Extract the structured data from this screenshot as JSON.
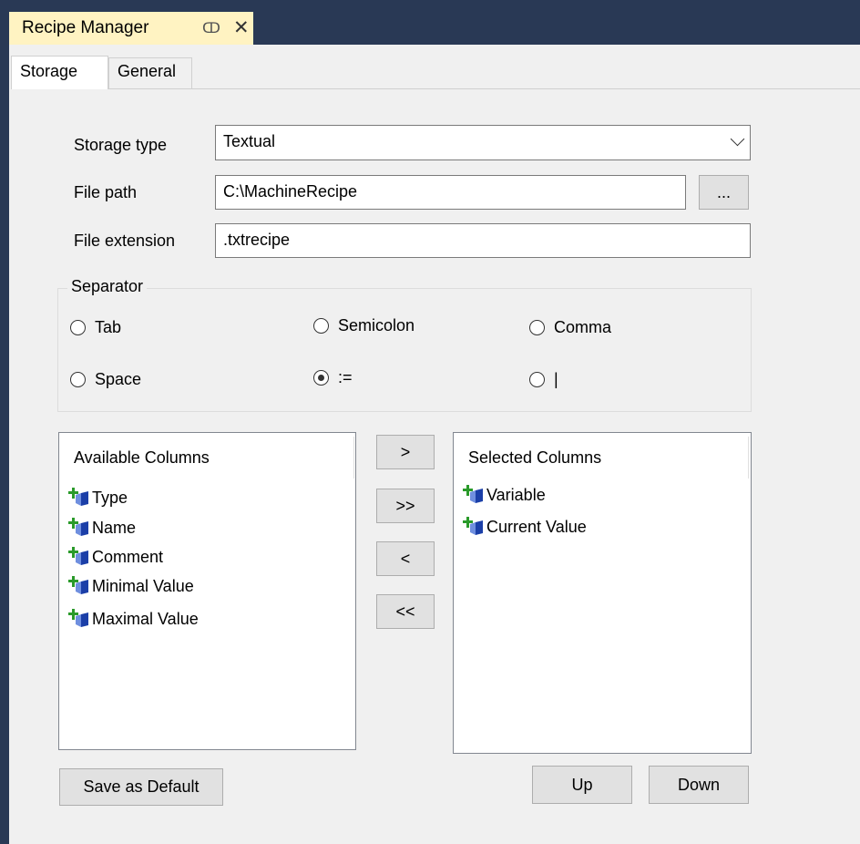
{
  "doc_tab": {
    "title": "Recipe Manager",
    "pin_glyph": "ↀ",
    "close_glyph": "✕"
  },
  "tabs": [
    {
      "label": "Storage"
    },
    {
      "label": "General"
    }
  ],
  "storage_type": {
    "label": "Storage type",
    "value": "Textual"
  },
  "file_path": {
    "label": "File path",
    "value": "C:\\MachineRecipe",
    "browse_label": "..."
  },
  "file_extension": {
    "label": "File extension",
    "value": ".txtrecipe"
  },
  "separator": {
    "title": "Separator",
    "options": [
      {
        "label": "Tab",
        "checked": false
      },
      {
        "label": "Semicolon",
        "checked": false
      },
      {
        "label": "Comma",
        "checked": false
      },
      {
        "label": "Space",
        "checked": false
      },
      {
        "label": ":=",
        "checked": true
      },
      {
        "label": "|",
        "checked": false
      }
    ]
  },
  "available_columns": {
    "header": "Available Columns",
    "items": [
      "Type",
      "Name",
      "Comment",
      "Minimal Value",
      "Maximal Value"
    ]
  },
  "selected_columns": {
    "header": "Selected Columns",
    "items": [
      "Variable",
      "Current Value"
    ]
  },
  "move_buttons": {
    "add": ">",
    "add_all": ">>",
    "remove": "<",
    "remove_all": "<<"
  },
  "buttons": {
    "save_default": "Save as Default",
    "up": "Up",
    "down": "Down"
  },
  "colors": {
    "frame": "#293955",
    "doc_tab": "#fff3c2",
    "panel": "#f0f0f0",
    "icon_plus": "#2a9a2a",
    "icon_cube": "#1b3fa8"
  },
  "icons": {
    "column_item": "add-column-icon"
  }
}
